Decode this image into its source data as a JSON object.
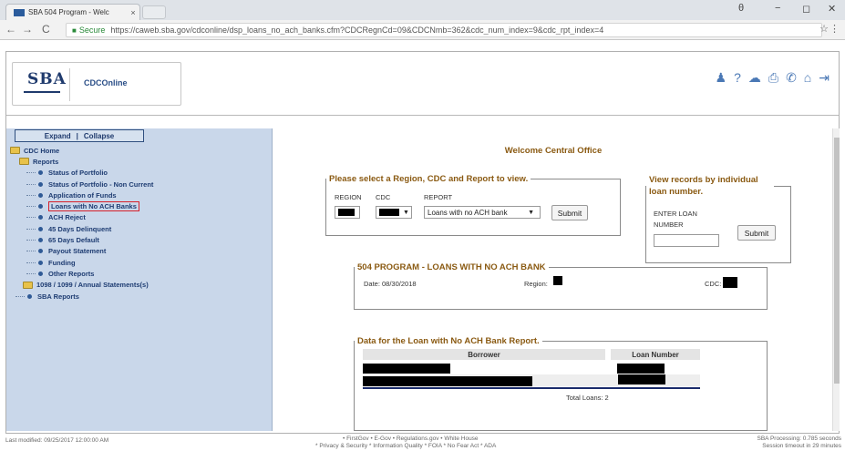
{
  "browser": {
    "tab_title": "SBA 504 Program - Welc",
    "tab_close": "×",
    "secure_label": "Secure",
    "url": "https://caweb.sba.gov/cdconline/dsp_loans_no_ach_banks.cfm?CDCRegnCd=09&CDCNmb=362&cdc_num_index=9&cdc_rpt_index=4",
    "back": "←",
    "forward": "→",
    "reload": "C",
    "star": "☆",
    "menu": "⋮",
    "account": "θ",
    "minimize": "−",
    "restore": "◻",
    "close": "✕"
  },
  "header": {
    "logo": "SBA",
    "app_name": "CDCOnline",
    "icons": [
      "person-icon",
      "help-icon",
      "chat-icon",
      "print-icon",
      "phone-icon",
      "home-icon",
      "logout-icon"
    ],
    "icon_glyphs": [
      "♟",
      "?",
      "☁",
      "⎙",
      "✆",
      "⌂",
      "⇥"
    ]
  },
  "sidebar": {
    "expand": "Expand",
    "collapse": "Collapse",
    "separator": "|",
    "root": "CDC Home",
    "reports": "Reports",
    "items": [
      "Status of Portfolio",
      "Status of Portfolio - Non Current",
      "Application of Funds",
      "Loans with No ACH Banks",
      "ACH Reject",
      "45 Days Delinquent",
      "65 Days Default",
      "Payout Statement",
      "Funding",
      "Other Reports"
    ],
    "annual": "1098 / 1099 / Annual Statements(s)",
    "sba_reports": "SBA Reports"
  },
  "main": {
    "welcome": "Welcome Central Office",
    "select_legend": "Please select a Region, CDC and Report to view.",
    "region_label": "REGION",
    "cdc_label": "CDC",
    "report_label": "REPORT",
    "report_value": "Loans with no ACH bank",
    "submit": "Submit",
    "view_legend": "View records by individual loan number.",
    "enter_loan_label": "ENTER LOAN NUMBER",
    "view_submit": "Submit",
    "program_legend": "504 PROGRAM - LOANS WITH NO ACH BANK",
    "date_text": "Date: 08/30/2018",
    "region_text": "Region:",
    "cdc_text": "CDC:",
    "data_legend": "Data for the Loan with No ACH Bank Report.",
    "col_borrower": "Borrower",
    "col_loan": "Loan Number",
    "total_loans": "Total Loans: 2"
  },
  "footer": {
    "last_modified": "Last modified: 09/25/2017 12:00:00 AM",
    "links_line1": "• FirstGov  • E-Gov  • Regulations.gov  • White House",
    "links_line2": "* Privacy & Security  * Information Quality  * FOIA  * No Fear Act  * ADA",
    "processing": "SBA Processing: 0.785 seconds",
    "session": "Session timeout in 29 minutes"
  }
}
